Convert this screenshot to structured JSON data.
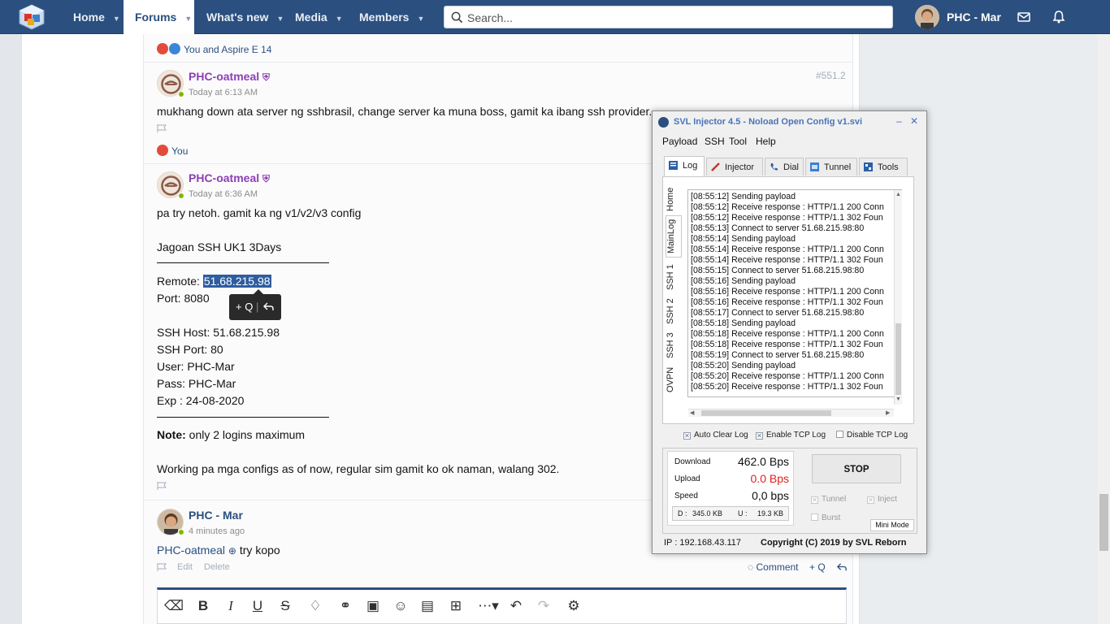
{
  "nav": {
    "tabs": [
      {
        "label": "Home"
      },
      {
        "label": "Forums"
      },
      {
        "label": "What's new"
      },
      {
        "label": "Media"
      },
      {
        "label": "Members"
      }
    ],
    "search_placeholder": "Search...",
    "user_name": "PHC - Mar"
  },
  "colors": {
    "nav_bg": "#2b4f7e",
    "username_purple": "#8c3fb5",
    "highlight": "#2e5da0"
  },
  "thread": {
    "reaction1": "You and Aspire E 14",
    "post1": {
      "user": "PHC-oatmeal",
      "time": "Today at 6:13 AM",
      "post_no": "#551.2",
      "body": "mukhang down ata server ng sshbrasil, change server ka muna boss, gamit ka ibang ssh provider."
    },
    "reaction2": "You",
    "post2": {
      "user": "PHC-oatmeal",
      "time": "Today at 6:36 AM",
      "line1": "pa try netoh. gamit ka ng v1/v2/v3 config",
      "line2": "Jagoan SSH UK1 3Days",
      "remote_label": "Remote:",
      "remote_value": "51.68.215.98",
      "port": "Port: 8080",
      "ssh_host": "SSH Host: 51.68.215.98",
      "ssh_port": "SSH Port: 80",
      "user_line": "User: PHC-Mar",
      "pass_line": "Pass: PHC-Mar",
      "exp_line": "Exp : 24-08-2020",
      "note_label": "Note:",
      "note_text": "only 2 logins maximum",
      "working": "Working pa mga configs as of now, regular sim gamit ko ok naman, walang 302."
    },
    "tooltip": {
      "plus": "+ Q",
      "divider": "|"
    },
    "post3": {
      "user": "PHC - Mar",
      "time": "4 minutes ago",
      "mention": "PHC-oatmeal",
      "body": "try kopo",
      "edit": "Edit",
      "delete": "Delete",
      "comment": "Comment",
      "plus_q": "+ Q"
    }
  },
  "injector": {
    "title": "SVL Injector 4.5 - Noload Open Config v1.svi",
    "minimize": "–",
    "close": "✕",
    "menu": [
      "Payload",
      "SSH",
      "Tool",
      "Help"
    ],
    "tabs": [
      "Log",
      "Injector",
      "Dial",
      "Tunnel",
      "Tools"
    ],
    "side_tabs": [
      "Home",
      "MainLog",
      "SSH 1",
      "SSH 2",
      "SSH 3",
      "OVPN"
    ],
    "log": [
      "[08:55:12] Sending payload",
      "[08:55:12] Receive response : HTTP/1.1 200 Conn",
      "[08:55:12] Receive response : HTTP/1.1 302 Foun",
      "[08:55:13] Connect to server 51.68.215.98:80",
      "[08:55:14] Sending payload",
      "[08:55:14] Receive response : HTTP/1.1 200 Conn",
      "[08:55:14] Receive response : HTTP/1.1 302 Foun",
      "[08:55:15] Connect to server 51.68.215.98:80",
      "[08:55:16] Sending payload",
      "[08:55:16] Receive response : HTTP/1.1 200 Conn",
      "[08:55:16] Receive response : HTTP/1.1 302 Foun",
      "[08:55:17] Connect to server 51.68.215.98:80",
      "[08:55:18] Sending payload",
      "[08:55:18] Receive response : HTTP/1.1 200 Conn",
      "[08:55:18] Receive response : HTTP/1.1 302 Foun",
      "[08:55:19] Connect to server 51.68.215.98:80",
      "[08:55:20] Sending payload",
      "[08:55:20] Receive response : HTTP/1.1 200 Conn",
      "[08:55:20] Receive response : HTTP/1.1 302 Foun"
    ],
    "checkboxes": {
      "auto_clear": "Auto Clear Log",
      "enable_tcp": "Enable TCP Log",
      "disable_tcp": "Disable TCP Log"
    },
    "stats": {
      "download_label": "Download",
      "download_value": "462.0 Bps",
      "upload_label": "Upload",
      "upload_value": "0.0 Bps",
      "speed_label": "Speed",
      "speed_value": "0,0 bps",
      "d_label": "D :",
      "d_value": "345.0 KB",
      "u_label": "U :",
      "u_value": "19.3 KB"
    },
    "stop_label": "STOP",
    "tunnel_label": "Tunnel",
    "inject_label": "Inject",
    "burst_label": "Burst",
    "mini_mode": "Mini Mode",
    "ip": "IP : 192.168.43.117",
    "copyright": "Copyright (C) 2019 by SVL Reborn"
  }
}
